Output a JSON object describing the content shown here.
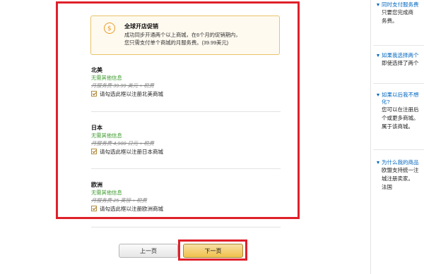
{
  "promo": {
    "title": "全球开店促销",
    "text_line1": "成功同步开通两个以上商城，在6个月的促销期内，",
    "text_line2": "您只需支付单个商城的月服务费。(39.99美元)"
  },
  "regions": [
    {
      "name": "北美",
      "free": "无需其他信息",
      "fee": "月服务费 39.99 美元 + 税费",
      "checkbox_label": "请勾选此框以注册北美商城"
    },
    {
      "name": "日本",
      "free": "无需其他信息",
      "fee": "月服务费 4,900 日元 + 税费",
      "checkbox_label": "请勾选此框以注册日本商城"
    },
    {
      "name": "欧洲",
      "free": "无需其他信息",
      "fee": "月服务费 25 英镑 + 税费",
      "checkbox_label": "请勾选此框以注册欧洲商城"
    }
  ],
  "buttons": {
    "prev": "上一页",
    "next": "下一页"
  },
  "sidebar": {
    "faq1_title": "同时支付服务费",
    "faq1_body": [
      "只要您完成商",
      "务费。"
    ],
    "faq2_title": "如果我选择两个",
    "faq2_body": [
      "即使选择了两个"
    ],
    "faq3_title": [
      "如果以后我不想",
      "化?"
    ],
    "faq3_body": [
      "您可以在注册后",
      "个或更多商城。",
      "属于该商城。"
    ],
    "faq4_title": "为什么我的商品",
    "faq4_body": [
      "欧盟支持统一注",
      "城注册卖家。",
      "法国"
    ]
  }
}
